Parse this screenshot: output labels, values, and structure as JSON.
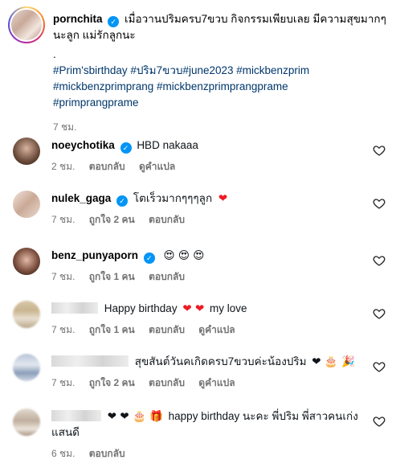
{
  "post": {
    "username": "pornchita",
    "caption_text": "เมื่อวานปริมครบ7ขวบ กิจกรรมเพียบเลย มีความสุขมากๆ นะลูก แม่รักลูกนะ",
    "dot": ".",
    "hashtags_line1": "#Prim'sbirthday #ปริม7ขวบ#june2023 #mickbenzprim",
    "hashtags_line2": "#mickbenzprimprang #mickbenzprimprangprame",
    "hashtags_line3": "#primprangprame",
    "time": "7 ชม."
  },
  "comments": [
    {
      "username": "noeychotika",
      "verified": true,
      "text": "HBD nakaaa",
      "time": "2 ชม.",
      "likes": "",
      "reply": "ตอบกลับ",
      "translate": "ดูคำแปล"
    },
    {
      "username": "nulek_gaga",
      "verified": true,
      "text": "โตเร็วมากๆๆๆลูก",
      "emoji": "❤",
      "time": "7 ชม.",
      "likes": "ถูกใจ 2 คน",
      "reply": "ตอบกลับ"
    },
    {
      "username": "benz_punyaporn",
      "verified": true,
      "text": "",
      "emoji": "😍 😍 😍",
      "time": "7 ชม.",
      "likes": "ถูกใจ 1 คน",
      "reply": "ตอบกลับ"
    },
    {
      "username": "",
      "text": "Happy birthday",
      "emoji": "❤ ❤",
      "text2": "my love",
      "time": "7 ชม.",
      "likes": "ถูกใจ 1 คน",
      "reply": "ตอบกลับ",
      "translate": "ดูคำแปล"
    },
    {
      "username": "",
      "text": "สุขสันต์วันคเกิดครบ7ขวบค่ะน้องปริม",
      "emoji": "❤ 🎂 🎉",
      "time": "7 ชม.",
      "likes": "ถูกใจ 2 คน",
      "reply": "ตอบกลับ",
      "translate": "ดูคำแปล"
    },
    {
      "username": "",
      "emoji": "❤ ❤ 🎂 🎁",
      "text": "happy birthday นะคะ พี่ปริม พี่สาวคนเก่ง",
      "text_line2": "แสนดี",
      "time": "6 ชม.",
      "reply": "ตอบกลับ"
    }
  ],
  "colors": {
    "verified": "#0095f6",
    "hashtag": "#00376b",
    "meta": "#737373",
    "heart": "#ed1c24"
  },
  "icons": {
    "like": "heart-outline-icon",
    "verified": "verified-badge-icon"
  }
}
